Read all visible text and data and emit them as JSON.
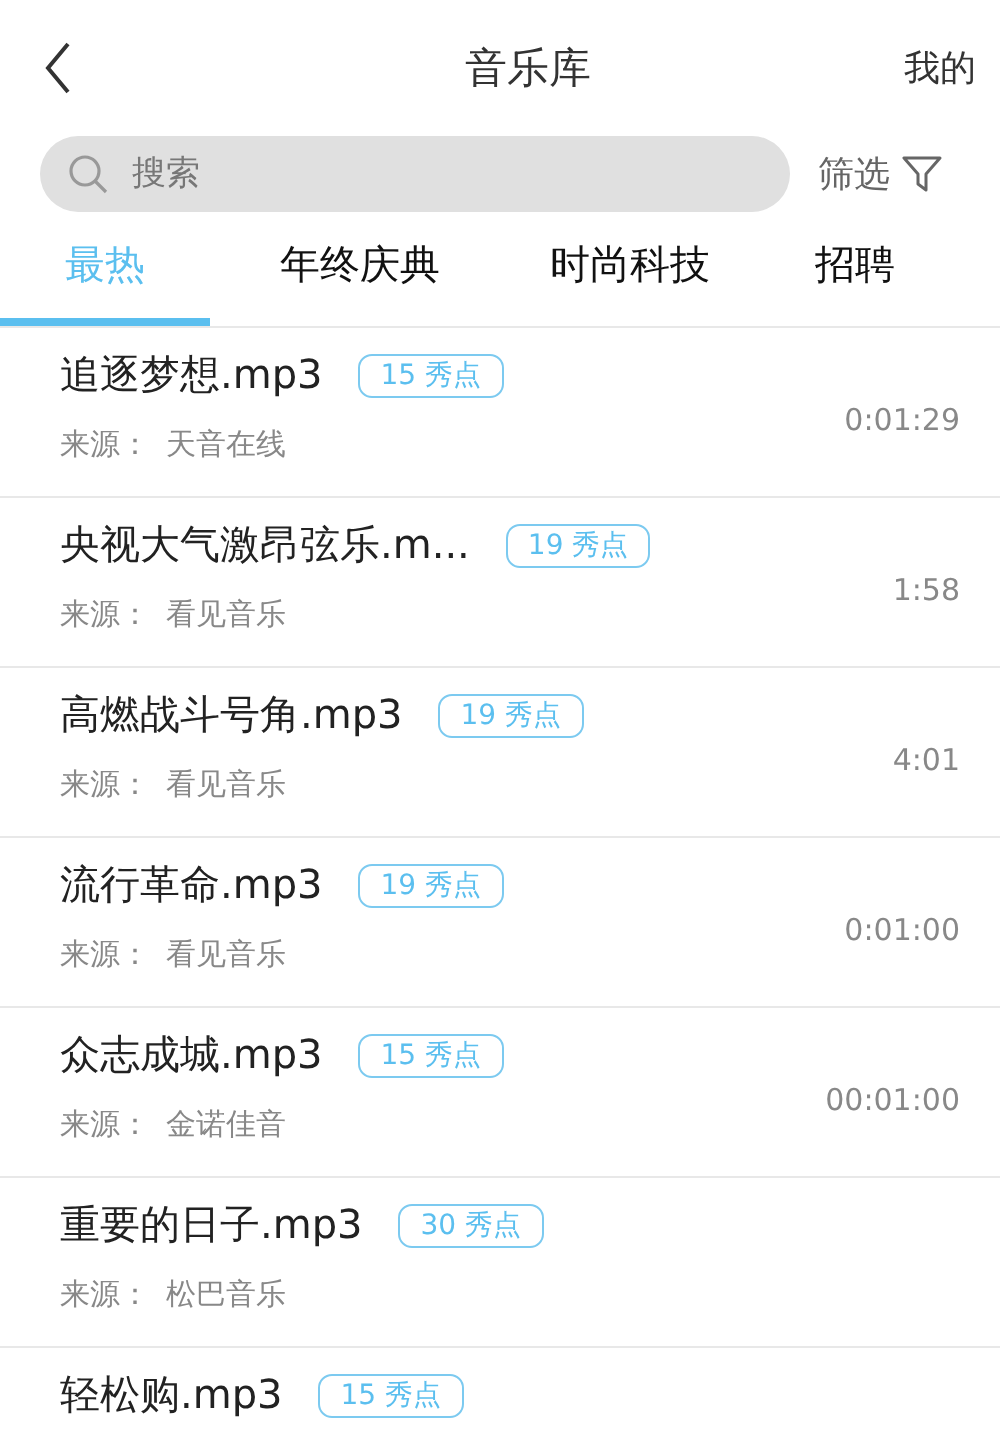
{
  "header": {
    "title": "音乐库",
    "right_link": "我的"
  },
  "search": {
    "placeholder": "搜索"
  },
  "filter": {
    "label": "筛选"
  },
  "tabs": [
    {
      "label": "最热",
      "selected": true
    },
    {
      "label": "年终庆典",
      "selected": false
    },
    {
      "label": "时尚科技",
      "selected": false
    },
    {
      "label": "招聘",
      "selected": false
    }
  ],
  "tracks": [
    {
      "name": "追逐梦想.mp3",
      "points": "15 秀点",
      "source_label": "来源：",
      "source": "天音在线",
      "duration": "0:01:29"
    },
    {
      "name": "央视大气激昂弦乐.m...",
      "points": "19 秀点",
      "source_label": "来源：",
      "source": "看见音乐",
      "duration": "1:58"
    },
    {
      "name": "高燃战斗号角.mp3",
      "points": "19 秀点",
      "source_label": "来源：",
      "source": "看见音乐",
      "duration": "4:01"
    },
    {
      "name": "流行革命.mp3",
      "points": "19 秀点",
      "source_label": "来源：",
      "source": "看见音乐",
      "duration": "0:01:00"
    },
    {
      "name": "众志成城.mp3",
      "points": "15 秀点",
      "source_label": "来源：",
      "source": "金诺佳音",
      "duration": "00:01:00"
    },
    {
      "name": "重要的日子.mp3",
      "points": "30 秀点",
      "source_label": "来源：",
      "source": "松巴音乐"
    },
    {
      "name": "轻松购.mp3",
      "points": "15 秀点"
    }
  ]
}
